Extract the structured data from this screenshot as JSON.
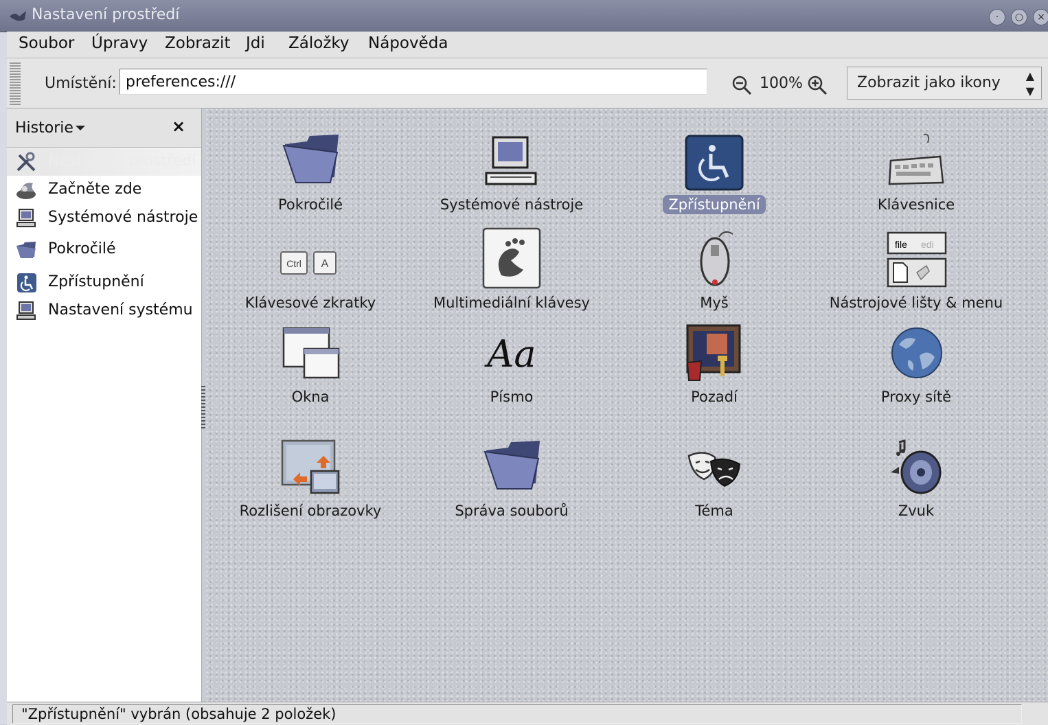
{
  "window": {
    "title": "Nastavení prostředí"
  },
  "menubar": [
    "Soubor",
    "Úpravy",
    "Zobrazit",
    "Jdi",
    "Záložky",
    "Nápověda"
  ],
  "location": {
    "label": "Umístění:",
    "value": "preferences:///",
    "zoom": "100%",
    "view_mode": "Zobrazit jako ikony"
  },
  "sidebar": {
    "title": "Historie",
    "close": "×",
    "items": [
      {
        "label": "Nastavení prostředí",
        "icon": "tools-icon",
        "selected": true
      },
      {
        "label": "Začněte zde",
        "icon": "start-here-icon"
      },
      {
        "label": "Systémové nástroje",
        "icon": "computer-icon"
      },
      {
        "label": "Pokročilé",
        "icon": "folder-icon"
      },
      {
        "label": "Zpřístupnění",
        "icon": "accessibility-icon"
      },
      {
        "label": "Nastavení systému",
        "icon": "computer-icon"
      }
    ]
  },
  "icons": [
    {
      "label": "Pokročilé",
      "icon": "folder-icon"
    },
    {
      "label": "Systémové nástroje",
      "icon": "computer-icon"
    },
    {
      "label": "Zpřístupnění",
      "icon": "accessibility-icon",
      "selected": true
    },
    {
      "label": "Klávesnice",
      "icon": "keyboard-icon"
    },
    {
      "label": "Klávesové zkratky",
      "icon": "shortcuts-icon",
      "keys": [
        "Ctrl",
        "A"
      ]
    },
    {
      "label": "Multimediální klávesy",
      "icon": "multimedia-keys-icon"
    },
    {
      "label": "Myš",
      "icon": "mouse-icon"
    },
    {
      "label": "Nástrojové lišty & menu",
      "icon": "toolbar-icon",
      "menu_text": [
        "file",
        "edi"
      ]
    },
    {
      "label": "Okna",
      "icon": "windows-icon"
    },
    {
      "label": "Písmo",
      "icon": "font-icon",
      "glyph": "Aa"
    },
    {
      "label": "Pozadí",
      "icon": "background-icon"
    },
    {
      "label": "Proxy sítě",
      "icon": "globe-icon"
    },
    {
      "label": "Rozlišení obrazovky",
      "icon": "screen-resolution-icon"
    },
    {
      "label": "Správa souborů",
      "icon": "folder-icon"
    },
    {
      "label": "Téma",
      "icon": "theme-masks-icon"
    },
    {
      "label": "Zvuk",
      "icon": "speaker-icon"
    }
  ],
  "status": "\"Zpřístupnění\" vybrán (obsahuje 2 položek)",
  "colors": {
    "selection": "#7f86a8",
    "titlebar": "#7a7f98",
    "icon_area": "#c6c9cf"
  }
}
